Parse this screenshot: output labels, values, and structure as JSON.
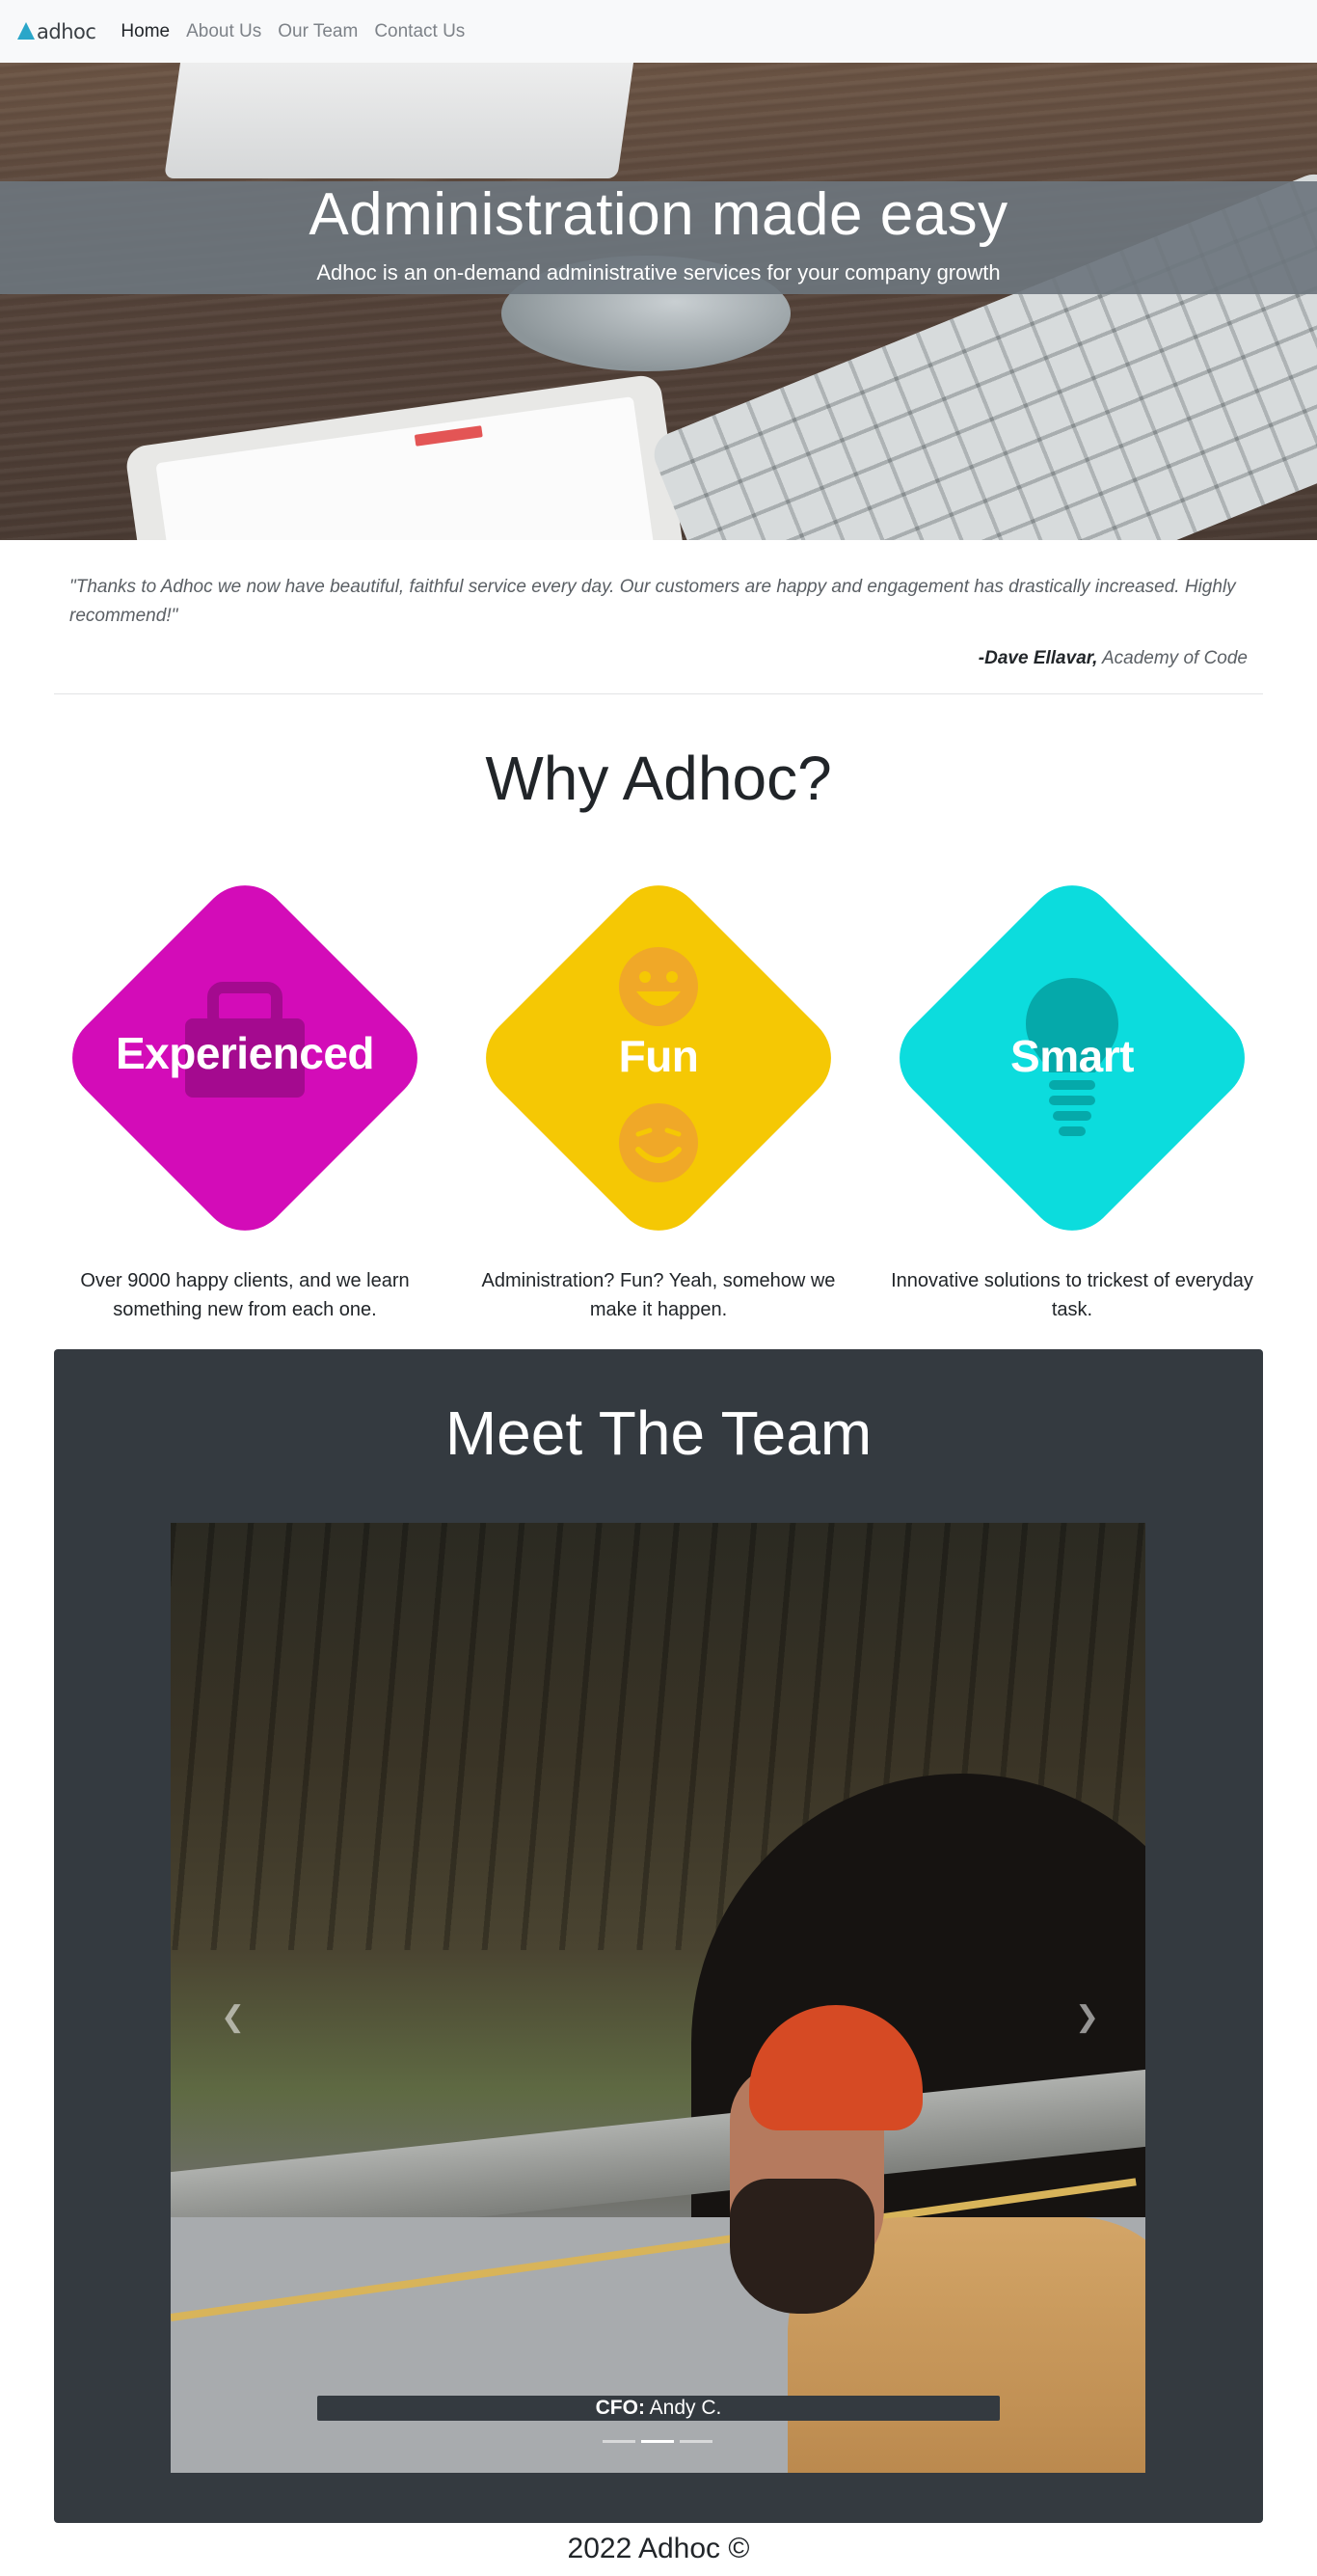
{
  "nav": {
    "brand": "adhoc",
    "links": [
      "Home",
      "About Us",
      "Our Team",
      "Contact Us"
    ],
    "active": "Home"
  },
  "hero": {
    "title": "Administration made easy",
    "subtitle": "Adhoc is an on-demand administrative services for your company growth"
  },
  "testimonial": {
    "quote": "\"Thanks to Adhoc we now have beautiful, faithful service every day. Our customers are happy and engagement has drastically increased. Highly recommend!\"",
    "author": "-Dave Ellavar,",
    "company": "Academy of Code"
  },
  "why": {
    "title": "Why Adhoc?",
    "cards": [
      {
        "label": "Experienced",
        "color": "#d30cb8",
        "description": "Over 9000 happy clients, and we learn something new from each one."
      },
      {
        "label": "Fun",
        "color": "#f5c804",
        "description": "Administration? Fun? Yeah, somehow we make it happen."
      },
      {
        "label": "Smart",
        "color": "#0cdcdd",
        "description": "Innovative solutions to trickest of everyday task."
      }
    ]
  },
  "team": {
    "title": "Meet The Team",
    "caption_role": "CFO:",
    "caption_name": " Andy C.",
    "slide_count": 3,
    "active_slide": 2
  },
  "footer": {
    "text": "2022 Adhoc ©"
  },
  "colors": {
    "navbar_bg": "#f8f9fa",
    "team_bg": "#343a40",
    "hero_band": "#6c757d"
  }
}
